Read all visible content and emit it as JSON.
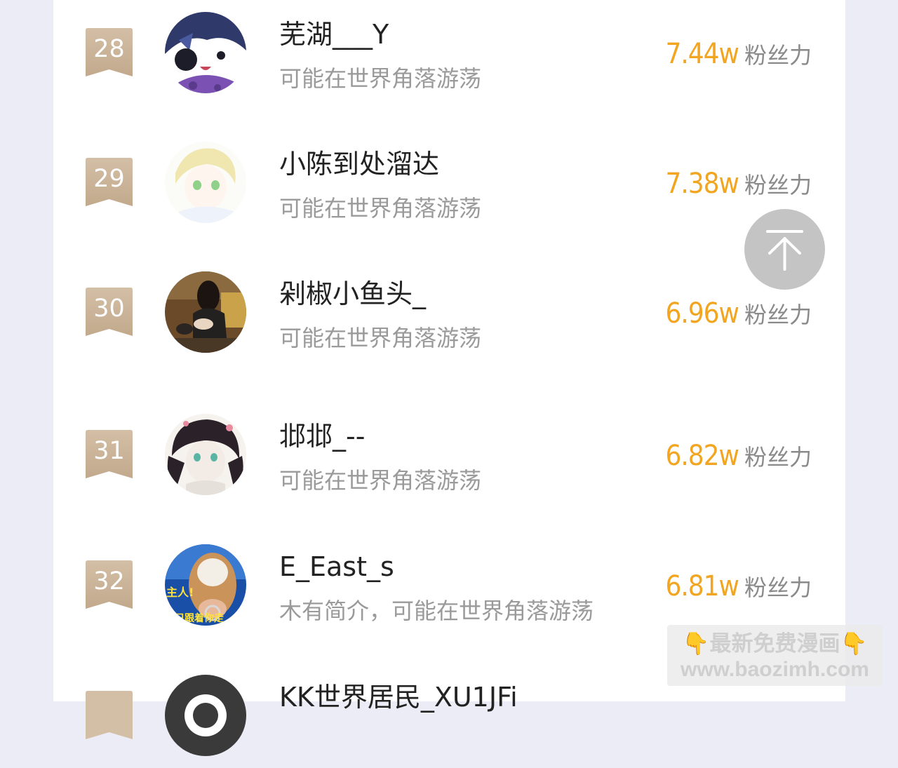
{
  "ranking": {
    "rows": [
      {
        "rank": "28",
        "name": "芜湖___Y",
        "bio": "可能在世界角落游荡",
        "fans_value": "7.44w",
        "fans_label": "粉丝力"
      },
      {
        "rank": "29",
        "name": "小陈到处溜达",
        "bio": "可能在世界角落游荡",
        "fans_value": "7.38w",
        "fans_label": "粉丝力"
      },
      {
        "rank": "30",
        "name": "剁椒小鱼头_",
        "bio": "可能在世界角落游荡",
        "fans_value": "6.96w",
        "fans_label": "粉丝力"
      },
      {
        "rank": "31",
        "name": "邶邶_--",
        "bio": "可能在世界角落游荡",
        "fans_value": "6.82w",
        "fans_label": "粉丝力"
      },
      {
        "rank": "32",
        "name": "E_East_s",
        "bio": "木有简介，可能在世界角落游荡",
        "fans_value": "6.81w",
        "fans_label": "粉丝力"
      },
      {
        "rank": "",
        "name": "KK世界居民_XU1JFi",
        "bio": "",
        "fans_value": "",
        "fans_label": ""
      }
    ]
  },
  "avatar_5_text": {
    "line1": "主人!",
    "line2": "只跟着你走"
  },
  "back_to_top": {
    "icon": "arrow-up-to-top-icon"
  },
  "watermark": {
    "line1": "最新免费漫画",
    "hand_icon": "👇",
    "line2": "www.baozimh.com"
  },
  "colors": {
    "background": "#ececf6",
    "fans_value": "#f2a520",
    "badge": "#c9b39a",
    "name": "#222222",
    "bio": "#9a9a9a"
  }
}
